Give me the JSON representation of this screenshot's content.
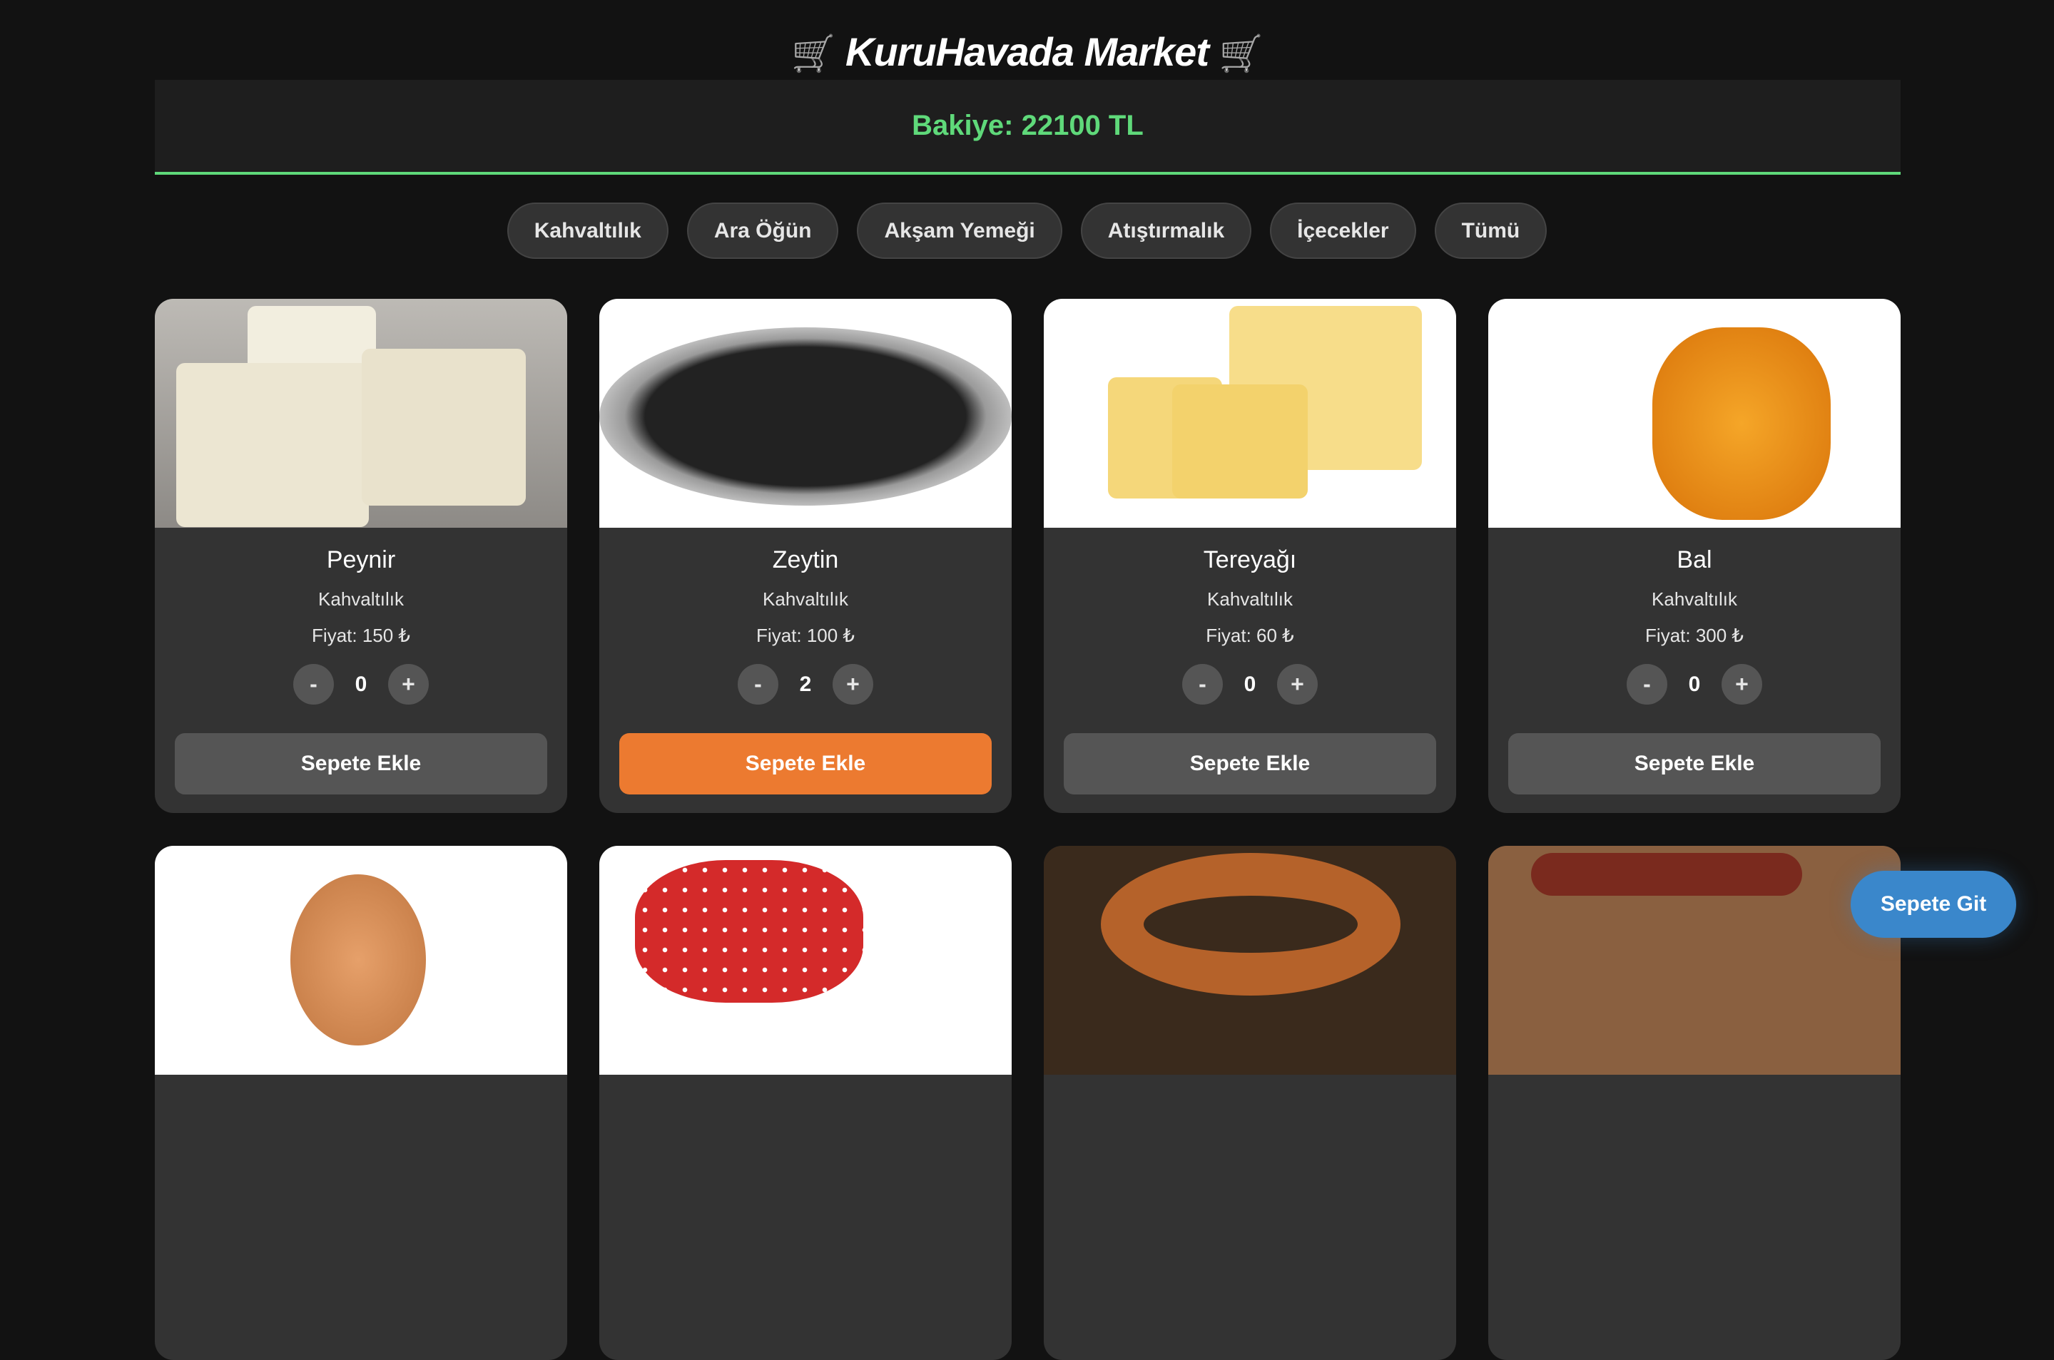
{
  "header": {
    "title": "KuruHavada Market",
    "cart_icon": "🛒"
  },
  "balance": {
    "text": "Bakiye: 22100 TL",
    "color": "#5fd97a"
  },
  "filters": [
    "Kahvaltılık",
    "Ara Öğün",
    "Akşam Yemeği",
    "Atıştırmalık",
    "İçecekler",
    "Tümü"
  ],
  "products": [
    {
      "name": "Peynir",
      "category": "Kahvaltılık",
      "price": "Fiyat: 150 ₺",
      "qty": "0"
    },
    {
      "name": "Zeytin",
      "category": "Kahvaltılık",
      "price": "Fiyat: 100 ₺",
      "qty": "2"
    },
    {
      "name": "Tereyağı",
      "category": "Kahvaltılık",
      "price": "Fiyat: 60 ₺",
      "qty": "0"
    },
    {
      "name": "Bal",
      "category": "Kahvaltılık",
      "price": "Fiyat: 300 ₺",
      "qty": "0"
    }
  ],
  "stepper": {
    "minus": "-",
    "plus": "+"
  },
  "add_label": "Sepete Ekle",
  "go_cart_label": "Sepete Git",
  "colors": {
    "accent": "#ec7a30",
    "button": "#3a87cb"
  }
}
